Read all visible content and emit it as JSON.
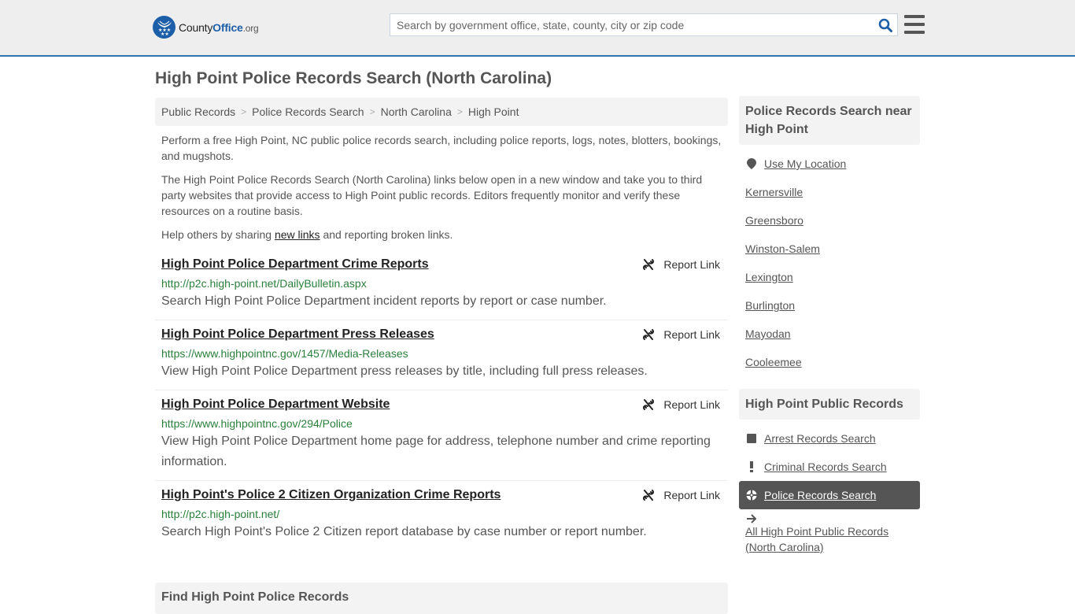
{
  "header": {
    "logo": {
      "name_part1": "County",
      "name_part2": "Office",
      "name_part3": ".org"
    },
    "search": {
      "placeholder": "Search by government office, state, county, city or zip code",
      "value": ""
    },
    "accent_color": "#2e75b0"
  },
  "page_title": "High Point Police Records Search (North Carolina)",
  "breadcrumb": [
    {
      "label": "Public Records"
    },
    {
      "label": "Police Records Search"
    },
    {
      "label": "North Carolina"
    },
    {
      "label": "High Point"
    }
  ],
  "intro": {
    "p1": "Perform a free High Point, NC public police records search, including police reports, logs, notes, blotters, bookings, and mugshots.",
    "p2": "The High Point Police Records Search (North Carolina) links below open in a new window and take you to third party websites that provide access to High Point public records. Editors frequently monitor and verify these resources on a routine basis.",
    "p3_before": "Help others by sharing ",
    "p3_link": "new links",
    "p3_after": " and reporting broken links."
  },
  "entries": [
    {
      "title": "High Point Police Department Crime Reports",
      "url": "http://p2c.high-point.net/DailyBulletin.aspx",
      "description": "Search High Point Police Department incident reports by report or case number.",
      "report_label": "Report Link"
    },
    {
      "title": "High Point Police Department Press Releases",
      "url": "https://www.highpointnc.gov/1457/Media-Releases",
      "description": "View High Point Police Department press releases by title, including full press releases.",
      "report_label": "Report Link"
    },
    {
      "title": "High Point Police Department Website",
      "url": "https://www.highpointnc.gov/294/Police",
      "description": "View High Point Police Department home page for address, telephone number and crime reporting information.",
      "report_label": "Report Link"
    },
    {
      "title": "High Point's Police 2 Citizen Organization Crime Reports",
      "url": "http://p2c.high-point.net/",
      "description": "Search High Point's Police 2 Citizen report database by case number or report number.",
      "report_label": "Report Link"
    }
  ],
  "find_box": {
    "title": "Find High Point Police Records"
  },
  "sidebar": {
    "nearby": {
      "title": "Police Records Search near High Point",
      "use_location": "Use My Location",
      "cities": [
        "Kernersville",
        "Greensboro",
        "Winston-Salem",
        "Lexington",
        "Burlington",
        "Mayodan",
        "Cooleemee"
      ]
    },
    "public_records": {
      "title": "High Point Public Records",
      "items": [
        {
          "label": "Arrest Records Search",
          "icon": "square-icon"
        },
        {
          "label": "Criminal Records Search",
          "icon": "exclamation-icon"
        },
        {
          "label": "Police Records Search",
          "icon": "crosshair-icon",
          "active": true
        },
        {
          "label": "All High Point Public Records (North Carolina)",
          "icon": "arrow-right-icon"
        }
      ]
    }
  }
}
